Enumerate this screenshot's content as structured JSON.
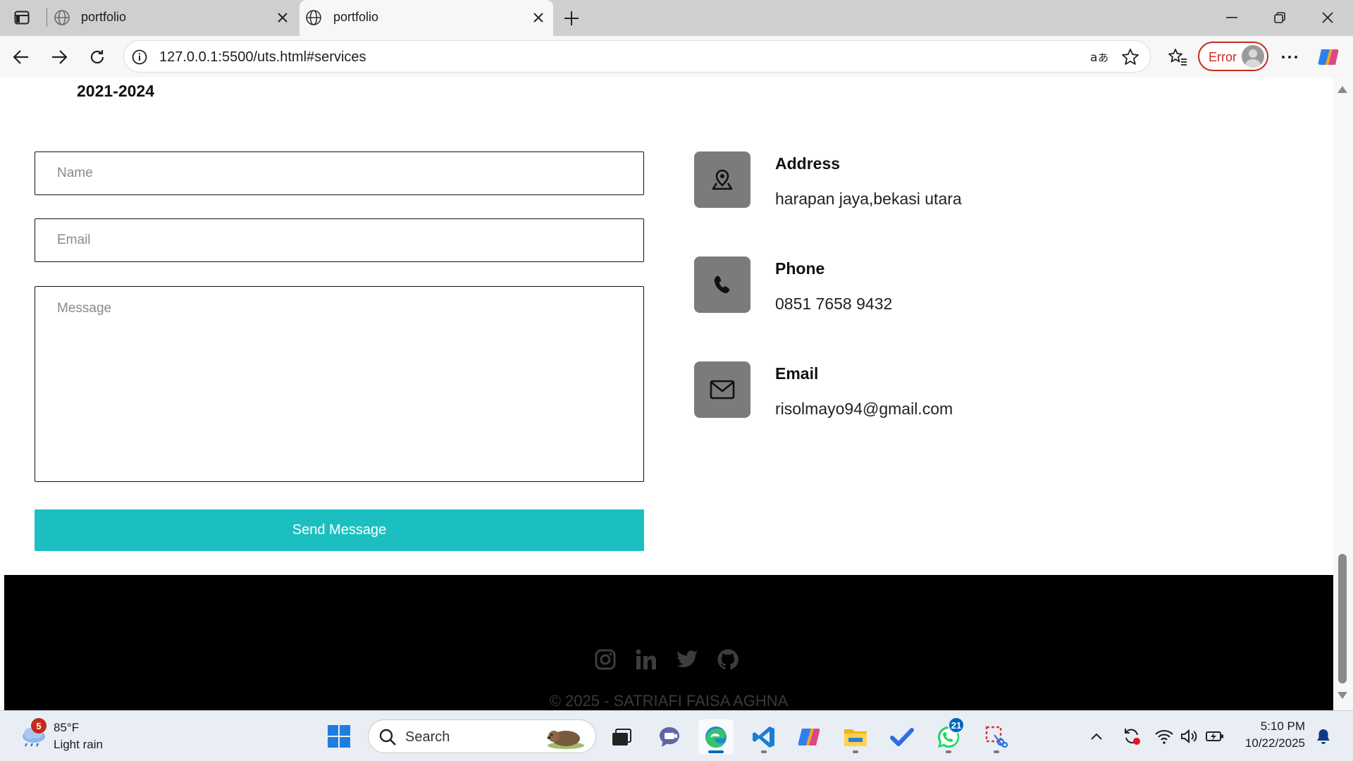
{
  "browser": {
    "tabs": [
      {
        "title": "portfolio",
        "active": false
      },
      {
        "title": "portfolio",
        "active": true
      }
    ],
    "address_url": "127.0.0.1:5500/uts.html#services",
    "profile_status": "Error"
  },
  "page": {
    "education_year": "2021-2024",
    "form": {
      "name_placeholder": "Name",
      "email_placeholder": "Email",
      "message_placeholder": "Message",
      "submit_label": "Send Message",
      "submit_color": "#1cbfbf"
    },
    "contact": [
      {
        "title": "Address",
        "value": "harapan jaya,bekasi utara",
        "icon": "map-pin-icon"
      },
      {
        "title": "Phone",
        "value": "0851 7658 9432",
        "icon": "phone-icon"
      },
      {
        "title": "Email",
        "value": "risolmayo94@gmail.com",
        "icon": "envelope-icon"
      }
    ],
    "footer": {
      "social_icons": [
        "instagram-icon",
        "linkedin-icon",
        "twitter-icon",
        "github-icon"
      ],
      "copyright": "© 2025 - SATRIAFI FAISA AGHNA"
    }
  },
  "taskbar": {
    "weather": {
      "badge": "5",
      "temperature": "85°F",
      "condition": "Light rain"
    },
    "search_label": "Search",
    "whatsapp_badge": "21",
    "clock": {
      "time": "5:10 PM",
      "date": "10/22/2025"
    }
  }
}
